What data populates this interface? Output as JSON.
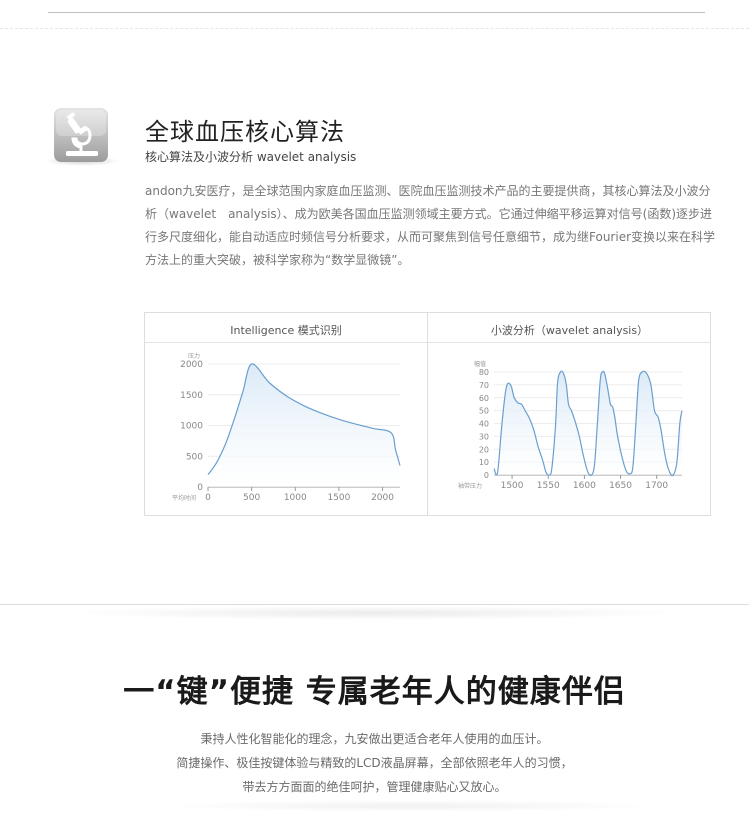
{
  "section1": {
    "icon": "microscope-icon",
    "title": "全球血压核心算法",
    "subtitle": "核心算法及小波分析 wavelet analysis",
    "paragraph": "andon九安医疗，是全球范围内家庭血压监测、医院血压监测技术产品的主要提供商，其核心算法及小波分析（wavelet　analysis）、成为欧美各国血压监测领域主要方式。它通过伸缩平移运算对信号(函数)逐步进行多尺度细化，能自动适应时频信号分析要求，从而可聚焦到信号任意细节，成为继Fourier变换以来在科学方法上的重大突破，被科学家称为“数学显微镜”。"
  },
  "chart_data": [
    {
      "type": "area",
      "title": "Intelligence 模式识别",
      "ylabel": "压力",
      "xlabel": "平均时间",
      "xlim": [
        0,
        2200
      ],
      "ylim": [
        0,
        2000
      ],
      "xticks": [
        0,
        500,
        1000,
        1500,
        2000
      ],
      "yticks": [
        0,
        500,
        1000,
        1500,
        2000
      ],
      "x": [
        0,
        100,
        200,
        300,
        400,
        500,
        700,
        900,
        1100,
        1300,
        1500,
        1700,
        1900,
        2100,
        2150,
        2200
      ],
      "y": [
        200,
        400,
        700,
        1100,
        1550,
        2000,
        1700,
        1480,
        1320,
        1200,
        1100,
        1020,
        950,
        880,
        600,
        350
      ],
      "color": "#6a9fd0",
      "fill": "#dbeaf7"
    },
    {
      "type": "area",
      "title": "小波分析（wavelet analysis）",
      "ylabel": "幅值",
      "xlabel": "袖带压力",
      "xlim": [
        1475,
        1735
      ],
      "ylim": [
        0,
        80
      ],
      "xticks": [
        1500,
        1550,
        1600,
        1650,
        1700
      ],
      "yticks": [
        0,
        10,
        20,
        30,
        40,
        50,
        60,
        70,
        80
      ],
      "x": [
        1475,
        1480,
        1486,
        1492,
        1498,
        1503,
        1508,
        1513,
        1518,
        1524,
        1530,
        1536,
        1542,
        1547,
        1551,
        1555,
        1560,
        1563,
        1567,
        1571,
        1575,
        1578,
        1582,
        1587,
        1593,
        1599,
        1605,
        1610,
        1614,
        1618,
        1622,
        1625,
        1628,
        1632,
        1636,
        1639,
        1642,
        1646,
        1652,
        1658,
        1663,
        1667,
        1671,
        1675,
        1680,
        1686,
        1692,
        1697,
        1702,
        1706,
        1712,
        1718,
        1723,
        1728,
        1732,
        1735
      ],
      "y": [
        5,
        2,
        40,
        68,
        70,
        60,
        56,
        55,
        50,
        44,
        35,
        22,
        12,
        2,
        0,
        5,
        38,
        72,
        80,
        79,
        70,
        55,
        50,
        42,
        30,
        14,
        2,
        0,
        8,
        40,
        74,
        80,
        79,
        68,
        55,
        53,
        45,
        30,
        14,
        3,
        1,
        6,
        38,
        73,
        80,
        79,
        70,
        50,
        45,
        35,
        14,
        2,
        0,
        10,
        40,
        50
      ],
      "color": "#6a9fd0",
      "fill": "#dbeaf7"
    }
  ],
  "section2": {
    "headline": "一“键”便捷 专属老年人的健康伴侣",
    "line1": "秉持人性化智能化的理念，九安做出更适合老年人使用的血压计。",
    "line2": "简捷操作、极佳按键体验与精致的LCD液晶屏幕，全部依照老年人的习惯，",
    "line3": "带去方方面面的绝佳呵护，管理健康贴心又放心。"
  }
}
